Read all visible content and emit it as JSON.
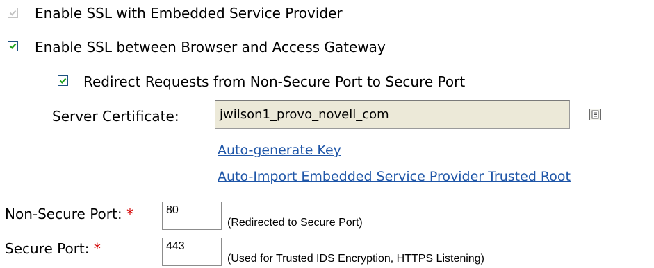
{
  "ssl_esp": {
    "label": "Enable SSL with Embedded Service Provider",
    "checked": true,
    "enabled": false
  },
  "ssl_browser": {
    "label": "Enable SSL between Browser and Access Gateway",
    "checked": true,
    "enabled": true
  },
  "redirect": {
    "label": "Redirect Requests from Non-Secure Port to Secure Port",
    "checked": true,
    "enabled": true
  },
  "server_certificate": {
    "label": "Server Certificate:",
    "value": "jwilson1_provo_novell_com",
    "browse_icon": "certificate-browse-icon"
  },
  "links": {
    "auto_generate_key": "Auto-generate Key",
    "auto_import_root": "Auto-Import Embedded Service Provider Trusted Root"
  },
  "non_secure_port": {
    "label": "Non-Secure Port:",
    "required_marker": "*",
    "value": "80",
    "note": "(Redirected to Secure Port)"
  },
  "secure_port": {
    "label": "Secure Port:",
    "required_marker": "*",
    "value": "443",
    "note": "(Used for Trusted IDS Encryption, HTTPS Listening)"
  },
  "colors": {
    "link": "#1f56a8",
    "required": "#d40000",
    "readonly_field": "#ece9d8"
  }
}
